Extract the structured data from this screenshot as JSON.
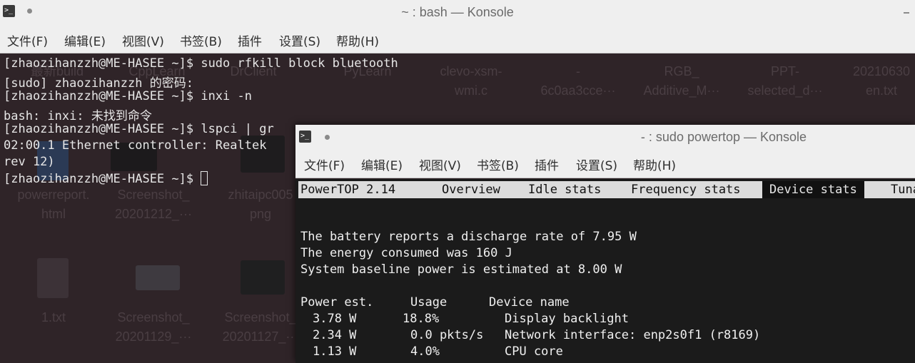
{
  "window_back": {
    "title": "~ : bash — Konsole",
    "menu": [
      "文件(F)",
      "编辑(E)",
      "视图(V)",
      "书签(B)",
      "插件",
      "设置(S)",
      "帮助(H)"
    ],
    "lines": [
      "[zhaozihanzzh@ME-HASEE ~]$ sudo rfkill block bluetooth",
      "[sudo] zhaozihanzzh 的密码:",
      "[zhaozihanzzh@ME-HASEE ~]$ inxi -n",
      "bash: inxi: 未找到命令",
      "[zhaozihanzzh@ME-HASEE ~]$ lspci | gr",
      "02:00.1 Ethernet controller: Realtek ",
      "rev 12)",
      "[zhaozihanzzh@ME-HASEE ~]$ "
    ]
  },
  "desktop_icons": [
    "最新build",
    "CppLearn",
    "DrClient",
    "PyLearn",
    "clevo-xsm-\nwmi.c",
    "-\n6c0aa3cce···",
    "RGB_\nAdditive_M···",
    "PPT-\nselected_d···",
    "20210630\nen.txt",
    "powerreport.\nhtml",
    "Screenshot_\n20201212_···",
    "zhitaipc005\npng",
    "1.txt",
    "Screenshot_\n20201129_···",
    "Screenshot_\n20201127_···"
  ],
  "window_front": {
    "title": "- : sudo powertop — Konsole",
    "menu": [
      "文件(F)",
      "编辑(E)",
      "视图(V)",
      "书签(B)",
      "插件",
      "设置(S)",
      "帮助(H)"
    ],
    "powertop": {
      "version": "PowerTOP 2.14",
      "tabs": [
        "Overview",
        "Idle stats",
        "Frequency stats",
        "Device stats",
        "Tuna"
      ],
      "active_tab": "Device stats",
      "summary": [
        "The battery reports a discharge rate of 7.95 W",
        "The energy consumed was 160 J",
        "System baseline power is estimated at 8.00 W"
      ],
      "table_header": [
        "Power est.",
        "Usage",
        "Device name"
      ],
      "rows": [
        {
          "power": "3.78 W",
          "usage": "18.8%",
          "device": "Display backlight"
        },
        {
          "power": "2.34 W",
          "usage": "0.0 pkts/s",
          "device": "Network interface: enp2s0f1 (r8169)"
        },
        {
          "power": "1.13 W",
          "usage": "4.0%",
          "device": "CPU core"
        }
      ]
    }
  }
}
